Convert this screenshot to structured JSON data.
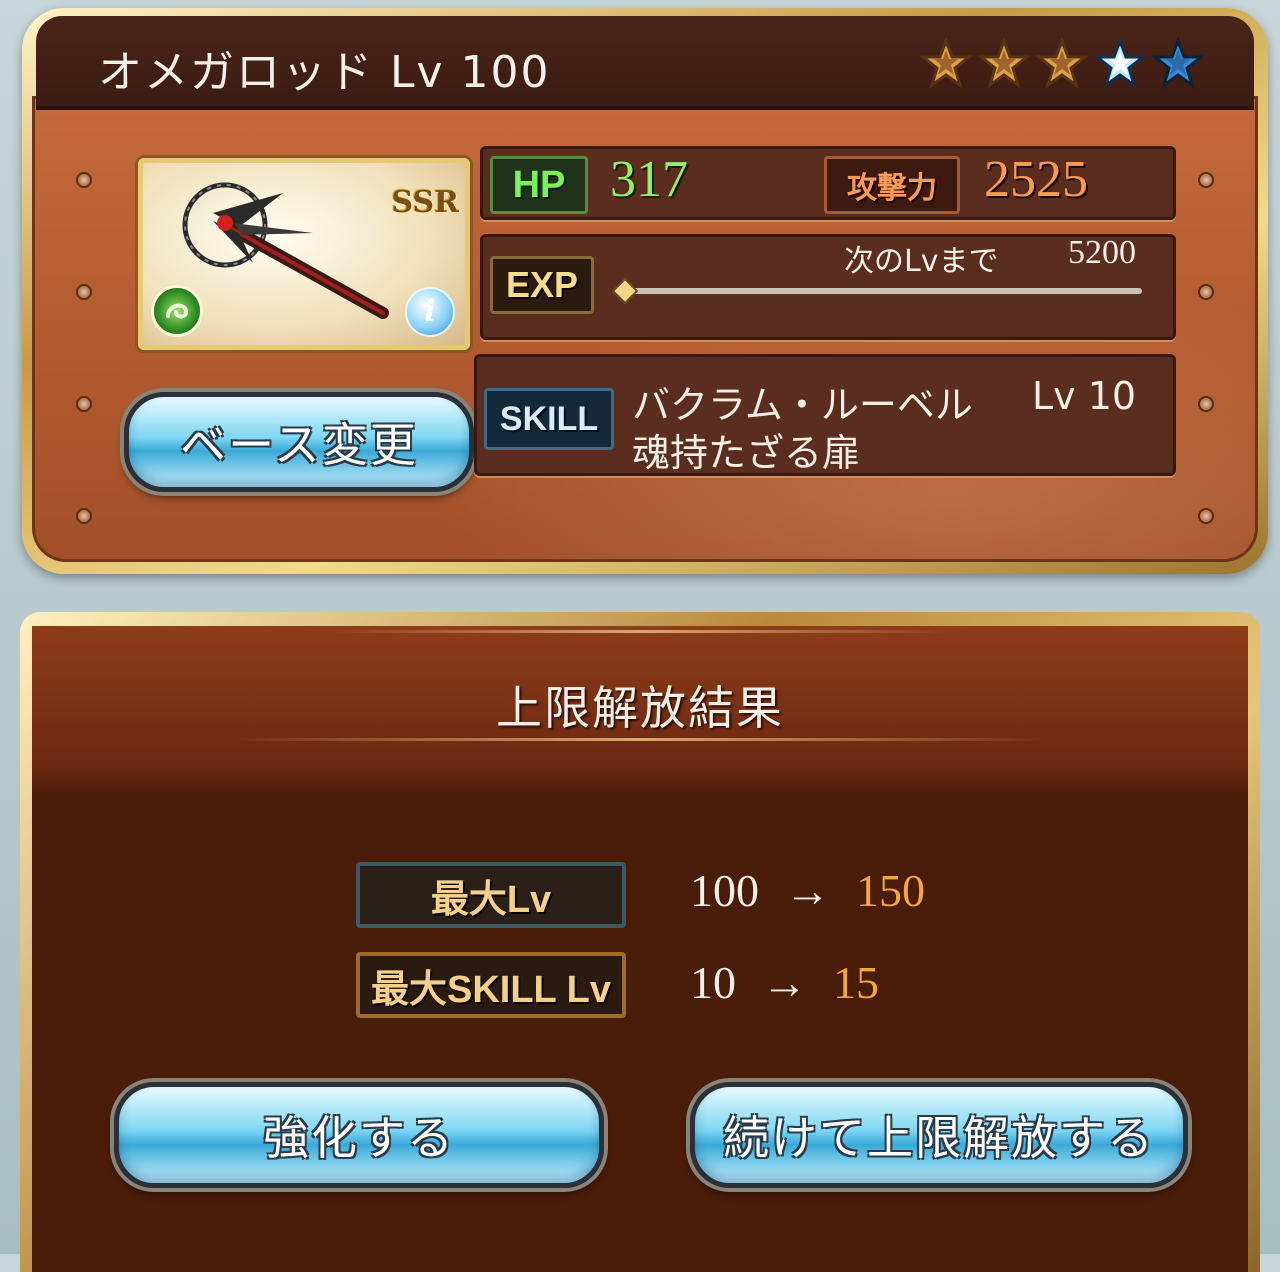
{
  "weapon": {
    "title": "オメガロッド Lv 100",
    "rarity": "SSR",
    "element_icon": "wind-element-icon",
    "info_icon_glyph": "i",
    "stars": {
      "filled": 3,
      "total": 5
    },
    "colors": {
      "star_gold": "#e6b04a",
      "star_blue": "#3a8ad4"
    }
  },
  "stats": {
    "hp_label": "HP",
    "hp_value": "317",
    "atk_label": "攻撃力",
    "atk_value": "2525",
    "exp_label": "EXP",
    "next_level_label": "次のLvまで",
    "next_level_value": "5200",
    "exp_progress": 0.0
  },
  "skill": {
    "label": "SKILL",
    "name": "バクラム・ルーベル",
    "level": "Lv 10",
    "subtitle": "魂持たざる扉"
  },
  "buttons": {
    "change_base": "ベース変更",
    "enhance": "強化する",
    "continue_uncap": "続けて上限解放する"
  },
  "result": {
    "title": "上限解放結果",
    "rows": [
      {
        "label": "最大Lv",
        "from": "100",
        "arrow": "→",
        "to": "150"
      },
      {
        "label": "最大SKILL Lv",
        "from": "10",
        "arrow": "→",
        "to": "15"
      }
    ]
  }
}
